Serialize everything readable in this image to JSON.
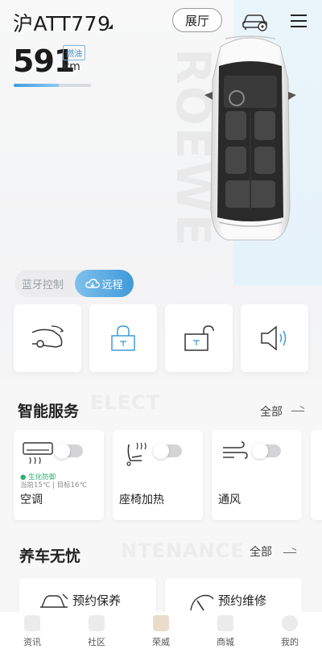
{
  "header": {
    "plate": "沪ATT779",
    "hall_label": "展厅",
    "car_icon": "car-settings-icon",
    "menu_icon": "menu-icon"
  },
  "vehicle": {
    "range_value": "591",
    "range_unit": "km",
    "fuel_tag": "燃油",
    "range_level": 0.58
  },
  "control_mode": {
    "bluetooth_label": "蓝牙控制",
    "remote_label": "远程",
    "active": "remote"
  },
  "controls": [
    {
      "icon": "trunk-icon"
    },
    {
      "icon": "lock-icon"
    },
    {
      "icon": "unlock-icon"
    },
    {
      "icon": "horn-icon"
    }
  ],
  "smart_services": {
    "title": "智能服务",
    "all_label": "全部",
    "items": [
      {
        "name": "空调",
        "icon": "ac-icon",
        "status": "● 生化防御",
        "temp": "当前15℃ | 目标16℃",
        "on": false
      },
      {
        "name": "座椅加热",
        "icon": "seat-heat-icon",
        "on": false
      },
      {
        "name": "通风",
        "icon": "ventilation-icon",
        "on": false
      }
    ]
  },
  "maintenance": {
    "title": "养车无忧",
    "all_label": "全部",
    "items": [
      {
        "name": "预约保养",
        "icon": "car-maintenance-icon"
      },
      {
        "name": "预约维修",
        "icon": "repair-icon"
      }
    ]
  },
  "bottom_nav": [
    {
      "label": "资讯",
      "icon": "news-icon"
    },
    {
      "label": "社区",
      "icon": "community-icon"
    },
    {
      "label": "荣威",
      "icon": "roewe-icon"
    },
    {
      "label": "商城",
      "icon": "shop-icon"
    },
    {
      "label": "我的",
      "icon": "profile-icon"
    }
  ],
  "colors": {
    "accent": "#3f9ad9",
    "status_green": "#2fb070"
  }
}
